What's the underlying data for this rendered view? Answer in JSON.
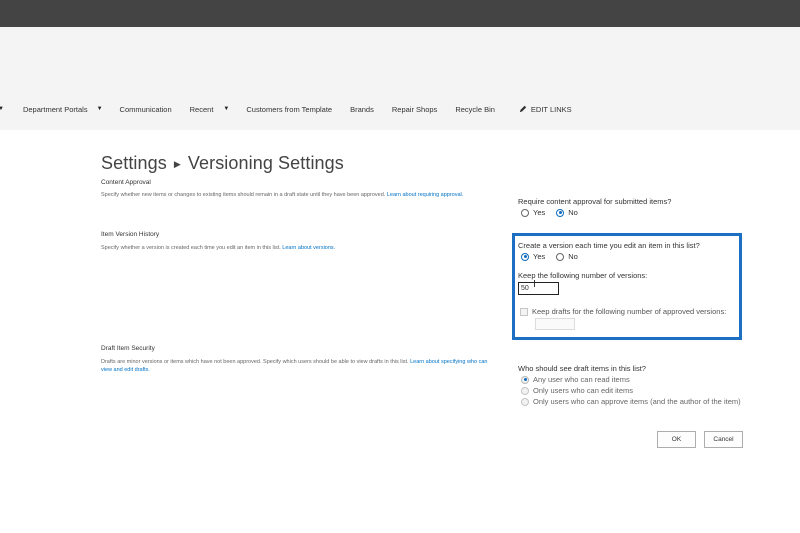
{
  "nav": {
    "items": [
      {
        "label": "Department Portals",
        "has_caret": true
      },
      {
        "label": "Communication",
        "has_caret": false
      },
      {
        "label": "Recent",
        "has_caret": true
      },
      {
        "label": "Customers from Template",
        "has_caret": false
      },
      {
        "label": "Brands",
        "has_caret": false
      },
      {
        "label": "Repair Shops",
        "has_caret": false
      },
      {
        "label": "Recycle Bin",
        "has_caret": false
      }
    ],
    "edit_links": "EDIT LINKS",
    "edit_icon": "pencil-icon"
  },
  "page": {
    "title_parent": "Settings",
    "title_current": "Versioning Settings"
  },
  "content_approval": {
    "heading": "Content Approval",
    "description": "Specify whether new items or changes to existing items should remain in a draft state until they have been approved.",
    "link": "Learn about requiring approval.",
    "question": "Require content approval for submitted items?",
    "yes": "Yes",
    "no": "No",
    "selected": "No"
  },
  "version_history": {
    "heading": "Item Version History",
    "description": "Specify whether a version is created each time you edit an item in this list.",
    "link": "Learn about versions.",
    "question": "Create a version each time you edit an item in this list?",
    "yes": "Yes",
    "no": "No",
    "selected": "Yes",
    "keep_label": "Keep the following number of versions:",
    "keep_value": "50",
    "drafts_label": "Keep drafts for the following number of approved versions:",
    "drafts_value": ""
  },
  "draft_security": {
    "heading": "Draft Item Security",
    "description": "Drafts are minor versions or items which have not been approved. Specify which users should be able to view drafts in this list.",
    "link": "Learn about specifying who can view and edit drafts.",
    "question": "Who should see draft items in this list?",
    "options": [
      "Any user who can read items",
      "Only users who can edit items",
      "Only users who can approve items (and the author of the item)"
    ],
    "selected_index": 0
  },
  "buttons": {
    "ok": "OK",
    "cancel": "Cancel"
  },
  "colors": {
    "topbar": "#444444",
    "accent": "#0072c6",
    "highlight_box": "#1d6fc2"
  }
}
